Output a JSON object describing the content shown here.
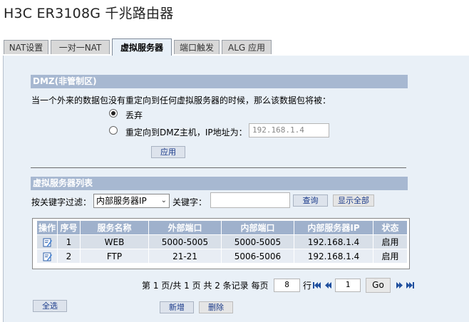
{
  "app_title": "H3C ER3108G 千兆路由器",
  "tabs": [
    {
      "label": "NAT设置"
    },
    {
      "label": "一对一NAT"
    },
    {
      "label": "虚拟服务器",
      "active": true
    },
    {
      "label": "端口触发"
    },
    {
      "label": "ALG 应用"
    }
  ],
  "dmz": {
    "section_title": "DMZ(非管制区)",
    "description": "当一个外来的数据包没有重定向到任何虚拟服务器的时候，那么该数据包将被：",
    "option_drop": "丢弃",
    "option_redirect": "重定向到DMZ主机，IP地址为：",
    "selected_option": "drop",
    "ip_value": "192.168.1.4",
    "apply_label": "应用"
  },
  "list": {
    "section_title": "虚拟服务器列表",
    "filter_label": "按关键字过滤：",
    "filter_selected": "内部服务器IP",
    "keyword_label": "关键字：",
    "keyword_value": "",
    "query_label": "查询",
    "show_all_label": "显示全部",
    "columns": [
      "操作",
      "序号",
      "服务名称",
      "外部端口",
      "内部端口",
      "内部服务器IP",
      "状态"
    ],
    "rows": [
      {
        "index": "1",
        "name": "WEB",
        "ext_port": "5000-5005",
        "int_port": "5000-5005",
        "ip": "192.168.1.4",
        "status": "启用"
      },
      {
        "index": "2",
        "name": "FTP",
        "ext_port": "21-21",
        "int_port": "5006-5006",
        "ip": "192.168.1.4",
        "status": "启用"
      }
    ]
  },
  "pager": {
    "summary": "第 1 页/共 1 页 共 2 条记录 每页",
    "per_page": "8",
    "rows_unit": "行",
    "page_input": "1",
    "go_label": "Go"
  },
  "actions": {
    "select_all": "全选",
    "add": "新增",
    "delete": "删除"
  },
  "colors": {
    "section_bar": "#a7b8d1",
    "table_header": "#9fb1cc",
    "panel_bg": "#e9f0f7",
    "link_blue": "#1a3a8a"
  }
}
